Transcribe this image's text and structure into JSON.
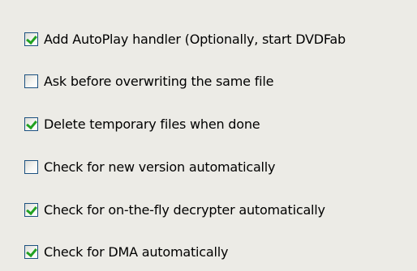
{
  "options": [
    {
      "label": "Add AutoPlay handler (Optionally, start DVDFab",
      "checked": true
    },
    {
      "label": "Ask before overwriting the same file",
      "checked": false
    },
    {
      "label": "Delete temporary files when done",
      "checked": true
    },
    {
      "label": "Check for new version automatically",
      "checked": false
    },
    {
      "label": "Check for on-the-fly decrypter automatically",
      "checked": true
    },
    {
      "label": "Check for DMA automatically",
      "checked": true
    }
  ],
  "colors": {
    "background": "#ecebe6",
    "checkbox_border": "#1c5180",
    "checkmark": "#21a121"
  }
}
